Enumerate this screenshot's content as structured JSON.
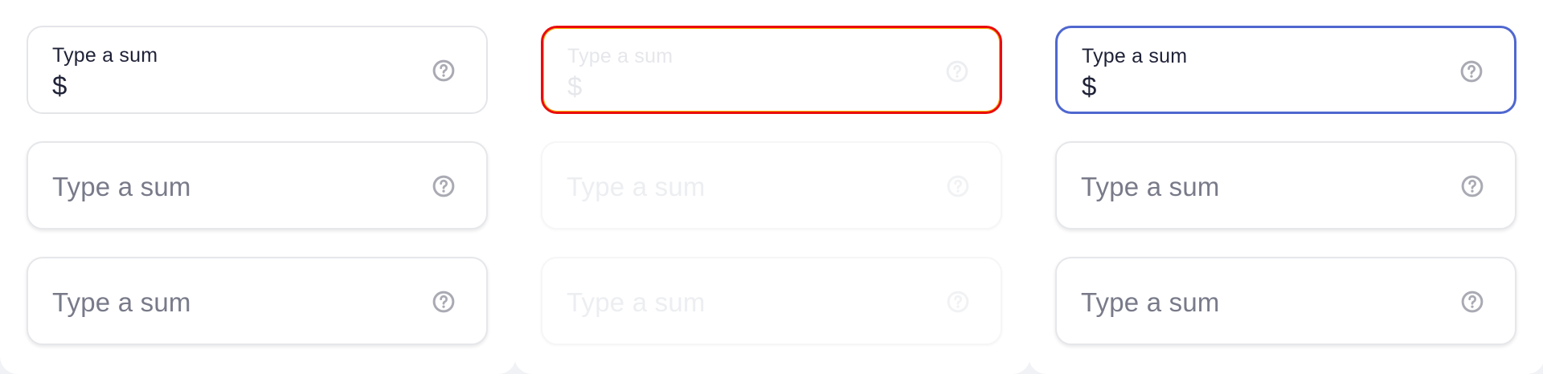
{
  "colors": {
    "text": "#1f2237",
    "placeholder": "#787a89",
    "help_icon": "#a9aab3",
    "error_border": "#ea0c0c",
    "focus_border": "#4f67cf",
    "disabled_text": "#e6e7eb"
  },
  "columns": [
    {
      "fields": [
        {
          "label": "Type a sum",
          "value": "$",
          "icon": "help-circle-icon"
        },
        {
          "placeholder": "Type a sum",
          "icon": "help-circle-icon"
        },
        {
          "placeholder": "Type a sum",
          "icon": "help-circle-icon"
        }
      ]
    },
    {
      "fields": [
        {
          "label": "Type a sum",
          "value": "$",
          "icon": "help-circle-icon"
        },
        {
          "placeholder": "Type a sum",
          "icon": "help-circle-icon"
        },
        {
          "placeholder": "Type a sum",
          "icon": "help-circle-icon"
        }
      ]
    },
    {
      "fields": [
        {
          "label": "Type a sum",
          "value": "$",
          "icon": "help-circle-icon"
        },
        {
          "placeholder": "Type a sum",
          "icon": "help-circle-icon"
        },
        {
          "placeholder": "Type a sum",
          "icon": "help-circle-icon"
        }
      ]
    }
  ]
}
